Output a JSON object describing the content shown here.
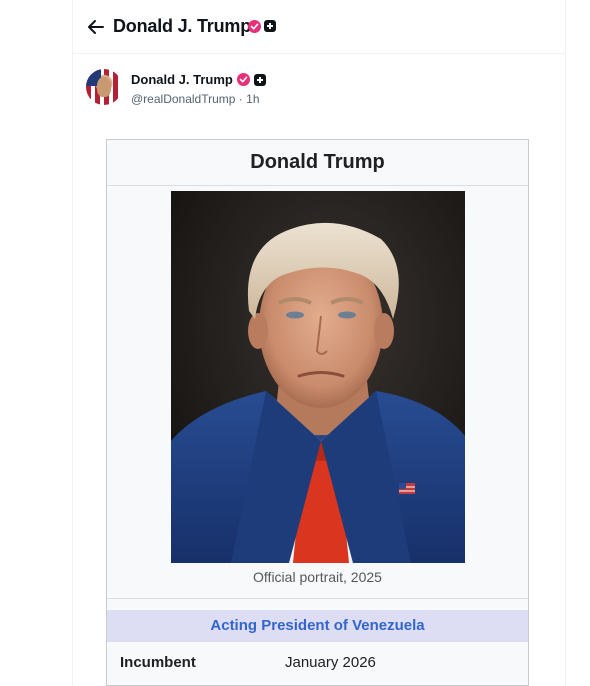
{
  "header": {
    "title": "Donald J. Trump"
  },
  "post": {
    "author_name": "Donald J. Trump",
    "handle": "@realDonaldTrump",
    "separator": "·",
    "time": "1h"
  },
  "infobox": {
    "title": "Donald Trump",
    "image_caption": "Official portrait, 2025",
    "section_header": "Acting President of Venezuela",
    "rows": [
      {
        "label": "Incumbent",
        "value": "January 2026"
      }
    ]
  },
  "icons": {
    "back": "arrow-left-icon",
    "verified": "verified-badge-icon",
    "affiliation": "plus-badge-icon"
  },
  "colors": {
    "verified_badge": "#e6307a",
    "section_header_bg": "#ddddf4",
    "section_header_text": "#3366cc",
    "suit": "#1f3c7a",
    "tie": "#d9351f"
  }
}
